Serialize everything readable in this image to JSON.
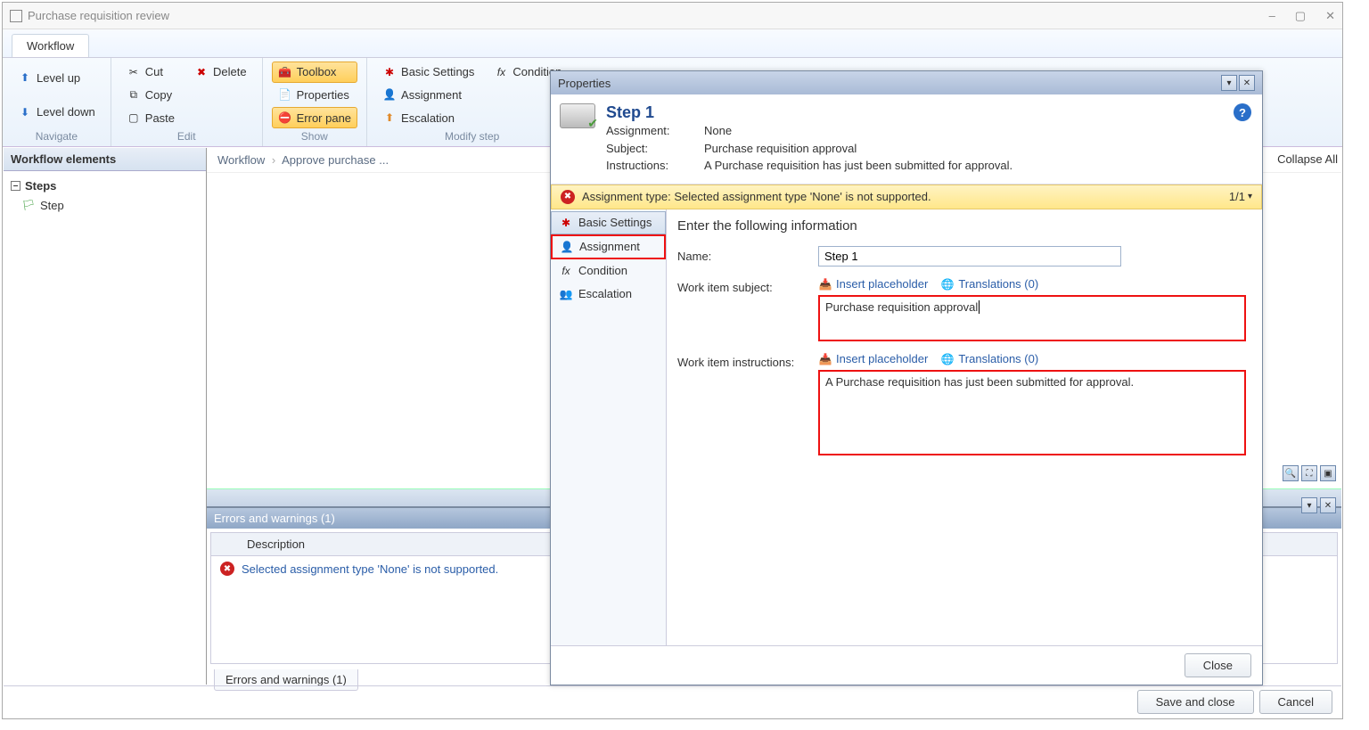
{
  "window": {
    "title": "Purchase requisition review"
  },
  "window_controls": {
    "min": "–",
    "max": "▢",
    "close": "✕"
  },
  "ribbon": {
    "tab": "Workflow",
    "groups": {
      "navigate": {
        "label": "Navigate",
        "level_up": "Level up",
        "level_down": "Level down"
      },
      "edit": {
        "label": "Edit",
        "cut": "Cut",
        "delete": "Delete",
        "copy": "Copy",
        "paste": "Paste"
      },
      "show": {
        "label": "Show",
        "toolbox": "Toolbox",
        "properties": "Properties",
        "error_pane": "Error pane"
      },
      "modify": {
        "label": "Modify step",
        "basic": "Basic Settings",
        "condition": "Condition",
        "assignment": "Assignment",
        "escalation": "Escalation"
      }
    }
  },
  "topright": {
    "collapse_all": "Collapse All"
  },
  "left_panel": {
    "title": "Workflow elements",
    "steps": "Steps",
    "step": "Step"
  },
  "breadcrumb": {
    "p1": "Workflow",
    "p2": "Approve purchase ..."
  },
  "errors_panel": {
    "title": "Errors and warnings (1)",
    "col_description": "Description",
    "row": "Selected assignment type 'None' is not supported.",
    "tab": "Errors and warnings (1)"
  },
  "footer": {
    "save_close": "Save and close",
    "cancel": "Cancel"
  },
  "dialog": {
    "title": "Properties",
    "head": {
      "step_title": "Step 1",
      "assignment_label": "Assignment:",
      "assignment_value": "None",
      "subject_label": "Subject:",
      "subject_value": "Purchase requisition approval",
      "instructions_label": "Instructions:",
      "instructions_value": "A Purchase requisition has just been submitted for approval."
    },
    "warn_bar": {
      "text": "Assignment type: Selected assignment type 'None' is not supported.",
      "count": "1/1"
    },
    "nav": {
      "basic": "Basic Settings",
      "assignment": "Assignment",
      "condition": "Condition",
      "escalation": "Escalation"
    },
    "form": {
      "heading": "Enter the following information",
      "name_label": "Name:",
      "name_value": "Step 1",
      "subject_label": "Work item subject:",
      "insert_placeholder": "Insert placeholder",
      "translations": "Translations (0)",
      "subject_value": "Purchase requisition approval",
      "instructions_label": "Work item instructions:",
      "instructions_value": "A Purchase requisition has just been submitted for approval."
    },
    "close": "Close"
  }
}
